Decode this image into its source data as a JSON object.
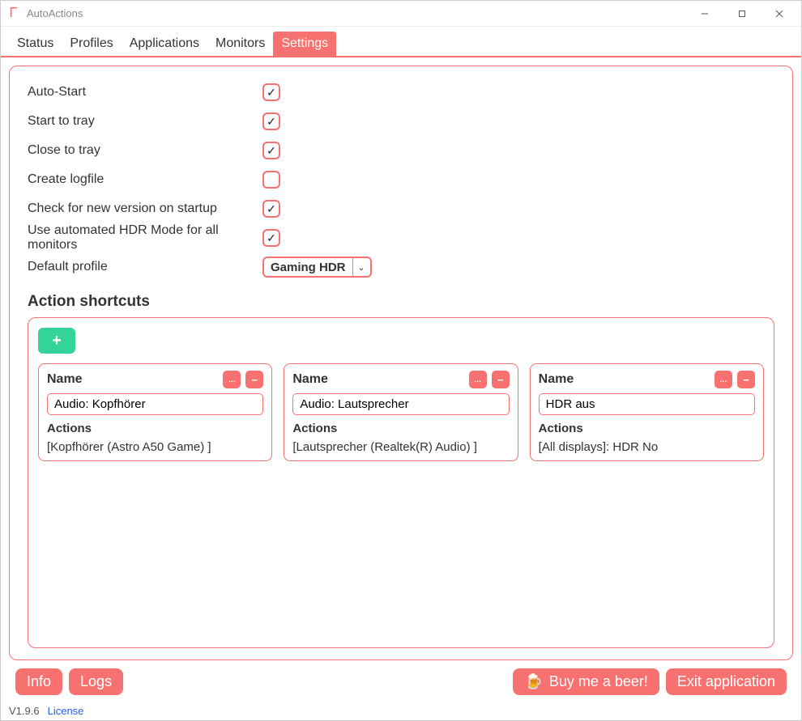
{
  "title": "AutoActions",
  "tabs": [
    "Status",
    "Profiles",
    "Applications",
    "Monitors",
    "Settings"
  ],
  "activeTabIndex": 4,
  "settings": {
    "items": [
      {
        "label": "Auto-Start",
        "checked": true
      },
      {
        "label": "Start to tray",
        "checked": true
      },
      {
        "label": "Close to tray",
        "checked": true
      },
      {
        "label": "Create logfile",
        "checked": false
      },
      {
        "label": "Check for new version on startup",
        "checked": true
      },
      {
        "label": "Use automated HDR Mode for all monitors",
        "checked": true
      }
    ],
    "defaultProfileLabel": "Default profile",
    "defaultProfileValue": "Gaming HDR"
  },
  "shortcuts": {
    "heading": "Action shortcuts",
    "nameLabel": "Name",
    "actionsLabel": "Actions",
    "cards": [
      {
        "name": "Audio: Kopfhörer",
        "actions": "[Kopfhörer (Astro A50 Game) ]"
      },
      {
        "name": "Audio: Lautsprecher",
        "actions": "[Lautsprecher (Realtek(R) Audio) ]"
      },
      {
        "name": "HDR aus",
        "actions": "[All displays]: HDR No"
      }
    ]
  },
  "footerButtons": {
    "info": "Info",
    "logs": "Logs",
    "beer": "Buy me a beer!",
    "exit": "Exit application"
  },
  "version": "V1.9.6",
  "licenseLink": "License"
}
